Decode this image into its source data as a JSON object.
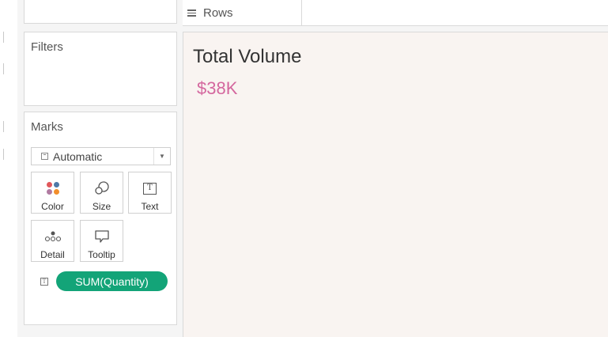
{
  "rows_shelf": {
    "label": "Rows"
  },
  "filters": {
    "title": "Filters"
  },
  "marks": {
    "title": "Marks",
    "mark_type": "Automatic",
    "buttons": {
      "color": "Color",
      "size": "Size",
      "text": "Text",
      "detail": "Detail",
      "tooltip": "Tooltip"
    },
    "pill": "SUM(Quantity)"
  },
  "viz": {
    "title": "Total Volume",
    "value": "$38K"
  },
  "colors": {
    "pill": "#13a478",
    "value_text": "#d4679e",
    "canvas_bg": "#f9f4f1"
  }
}
